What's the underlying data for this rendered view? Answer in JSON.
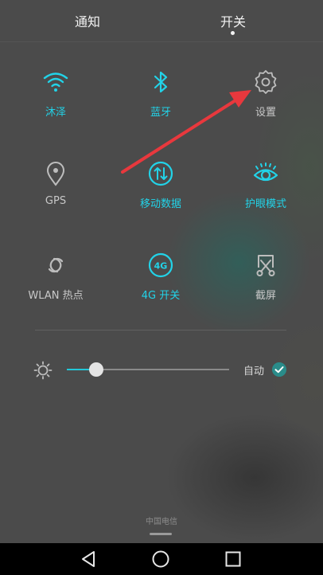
{
  "tabs": [
    {
      "label": "通知"
    },
    {
      "label": "开关"
    }
  ],
  "tiles": [
    {
      "label": "沐泽",
      "icon": "wifi-icon",
      "state": "on"
    },
    {
      "label": "蓝牙",
      "icon": "bluetooth-icon",
      "state": "on"
    },
    {
      "label": "设置",
      "icon": "gear-icon",
      "state": "off"
    },
    {
      "label": "GPS",
      "icon": "location-pin-icon",
      "state": "off"
    },
    {
      "label": "移动数据",
      "icon": "mobile-data-icon",
      "state": "on"
    },
    {
      "label": "护眼模式",
      "icon": "eye-icon",
      "state": "on"
    },
    {
      "label": "WLAN 热点",
      "icon": "hotspot-icon",
      "state": "off"
    },
    {
      "label": "4G 开关",
      "icon": "4g-icon",
      "state": "on",
      "badge": "4G"
    },
    {
      "label": "截屏",
      "icon": "screenshot-icon",
      "state": "off"
    }
  ],
  "brightness": {
    "level": 0.18,
    "auto_label": "自动",
    "auto_enabled": true
  },
  "carrier": "中国电信",
  "colors": {
    "accent": "#22d3e8",
    "annotation_arrow": "#e8383d",
    "check": "#2a8c8a"
  }
}
